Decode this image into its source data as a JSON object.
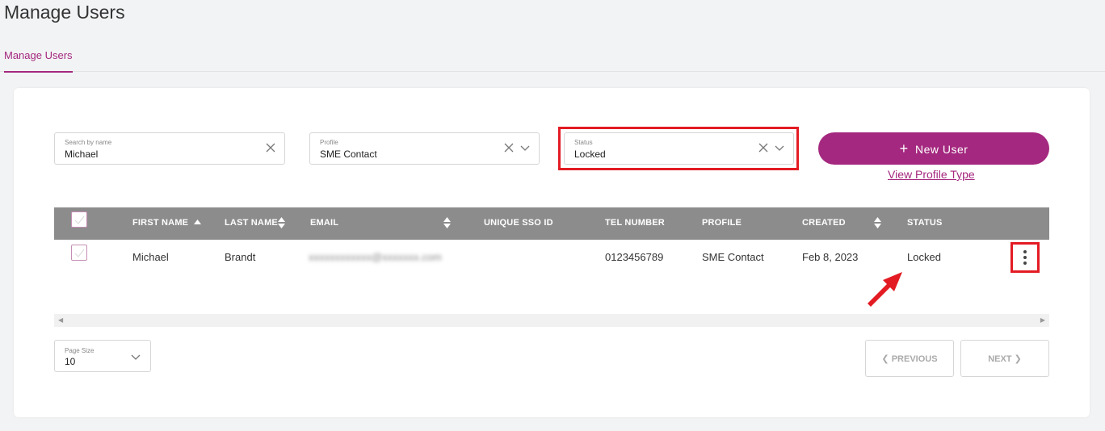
{
  "page": {
    "title": "Manage Users"
  },
  "tabs": [
    {
      "label": "Manage Users",
      "active": true
    }
  ],
  "filters": {
    "search": {
      "label": "Search by name",
      "value": "Michael"
    },
    "profile": {
      "label": "Profile",
      "value": "SME Contact"
    },
    "status": {
      "label": "Status",
      "value": "Locked"
    }
  },
  "actions": {
    "new_user_label": "New User",
    "view_profile_type_label": "View Profile Type"
  },
  "table": {
    "columns": [
      "FIRST NAME",
      "LAST NAME",
      "EMAIL",
      "UNIQUE SSO ID",
      "TEL NUMBER",
      "PROFILE",
      "CREATED",
      "STATUS"
    ],
    "rows": [
      {
        "first_name": "Michael",
        "last_name": "Brandt",
        "email": "xxxxxxxxxxxx@xxxxxxx.com",
        "unique_sso_id": "",
        "tel_number": "0123456789",
        "profile": "SME Contact",
        "created": "Feb 8, 2023",
        "status": "Locked"
      }
    ]
  },
  "pagination": {
    "page_size_label": "Page Size",
    "page_size_value": "10",
    "previous_label": "PREVIOUS",
    "next_label": "NEXT"
  },
  "colors": {
    "accent": "#a4287f",
    "highlight": "#e31b23",
    "table_header": "#8c8c8c"
  },
  "icons": [
    "clear-icon",
    "chevron-down-icon",
    "plus-icon",
    "sort-asc-icon",
    "sort-both-icon",
    "checkmark-icon",
    "kebab-menu-icon",
    "chevron-left-icon",
    "chevron-right-icon",
    "scroll-left-icon",
    "scroll-right-icon",
    "annotation-arrow"
  ]
}
